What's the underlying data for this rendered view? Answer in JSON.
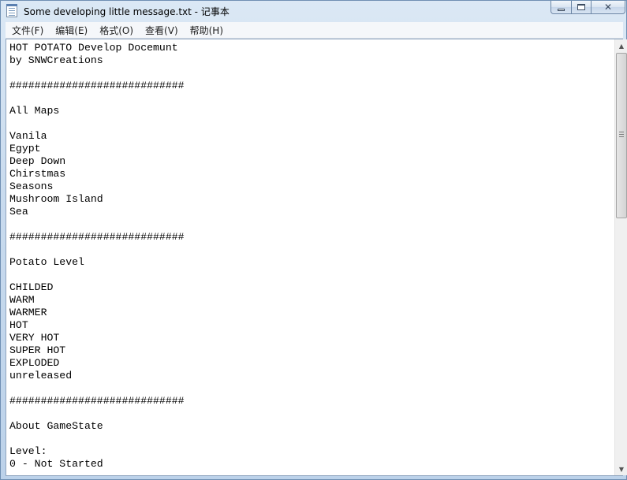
{
  "window": {
    "title": "Some developing little message.txt - 记事本"
  },
  "title_buttons": {
    "minimize_icon": "minimize-icon",
    "maximize_icon": "maximize-icon",
    "close_icon": "close-icon"
  },
  "menu": {
    "items": [
      {
        "label": "文件(F)"
      },
      {
        "label": "编辑(E)"
      },
      {
        "label": "格式(O)"
      },
      {
        "label": "查看(V)"
      },
      {
        "label": "帮助(H)"
      }
    ]
  },
  "document": {
    "text": "HOT POTATO Develop Docemunt\nby SNWCreations\n\n############################\n\nAll Maps\n\nVanila\nEgypt\nDeep Down\nChirstmas\nSeasons\nMushroom Island\nSea\n\n############################\n\nPotato Level\n\nCHILDED\nWARM\nWARMER\nHOT\nVERY HOT\nSUPER HOT\nEXPLODED\nunreleased\n\n############################\n\nAbout GameState\n\nLevel:\n0 - Not Started"
  },
  "scrollbar": {
    "up_arrow": "▲",
    "down_arrow": "▼",
    "position_fraction": 0.0
  }
}
